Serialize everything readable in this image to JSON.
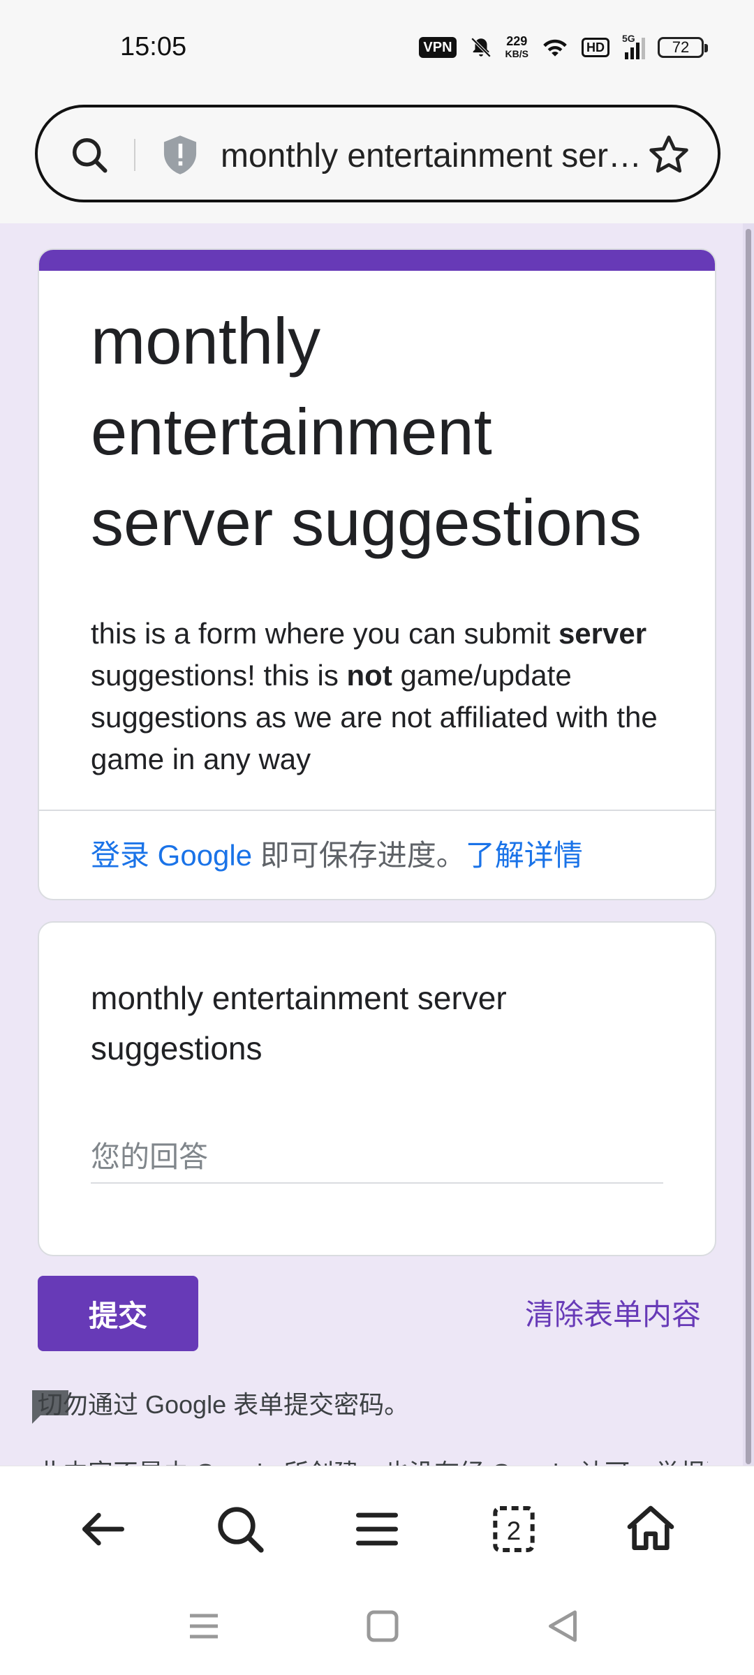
{
  "status_bar": {
    "time": "15:05",
    "vpn": "VPN",
    "net_speed_value": "229",
    "net_speed_unit": "KB/S",
    "hd": "HD",
    "network": "5G",
    "battery": "72"
  },
  "url_bar": {
    "text": "monthly entertainment server suggestions"
  },
  "form": {
    "title": "monthly entertainment server suggestions",
    "description_part1": "this is a form where you can submit ",
    "description_bold1": "server",
    "description_part2": " suggestions! this is ",
    "description_bold2": "not",
    "description_part3": " game/update suggestions as we are not affiliated with the game in any way",
    "signin_link": "登录 Google",
    "signin_text": " 即可保存进度。",
    "learn_more_link": "了解详情"
  },
  "question": {
    "title": "monthly entertainment server suggestions",
    "placeholder": "您的回答",
    "value": ""
  },
  "actions": {
    "submit_label": "提交",
    "clear_label": "清除表单内容"
  },
  "footer": {
    "warning": "切勿通过 Google 表单提交密码。",
    "partial_text": "此内容不是由 Google 所创建，也没有经 Google 认可。举报滥用行为"
  },
  "icons": {
    "url_search": "search-icon",
    "url_security": "shield-icon",
    "url_bookmark": "star-icon",
    "nav_back": "back-arrow-icon",
    "nav_search": "search-icon",
    "nav_menu": "menu-icon",
    "nav_tabs": "tabs-icon",
    "nav_home": "home-icon"
  },
  "tabs_count": "2",
  "colors": {
    "accent": "#673ab7",
    "page_background": "#ede7f6",
    "link": "#1a73e8"
  }
}
